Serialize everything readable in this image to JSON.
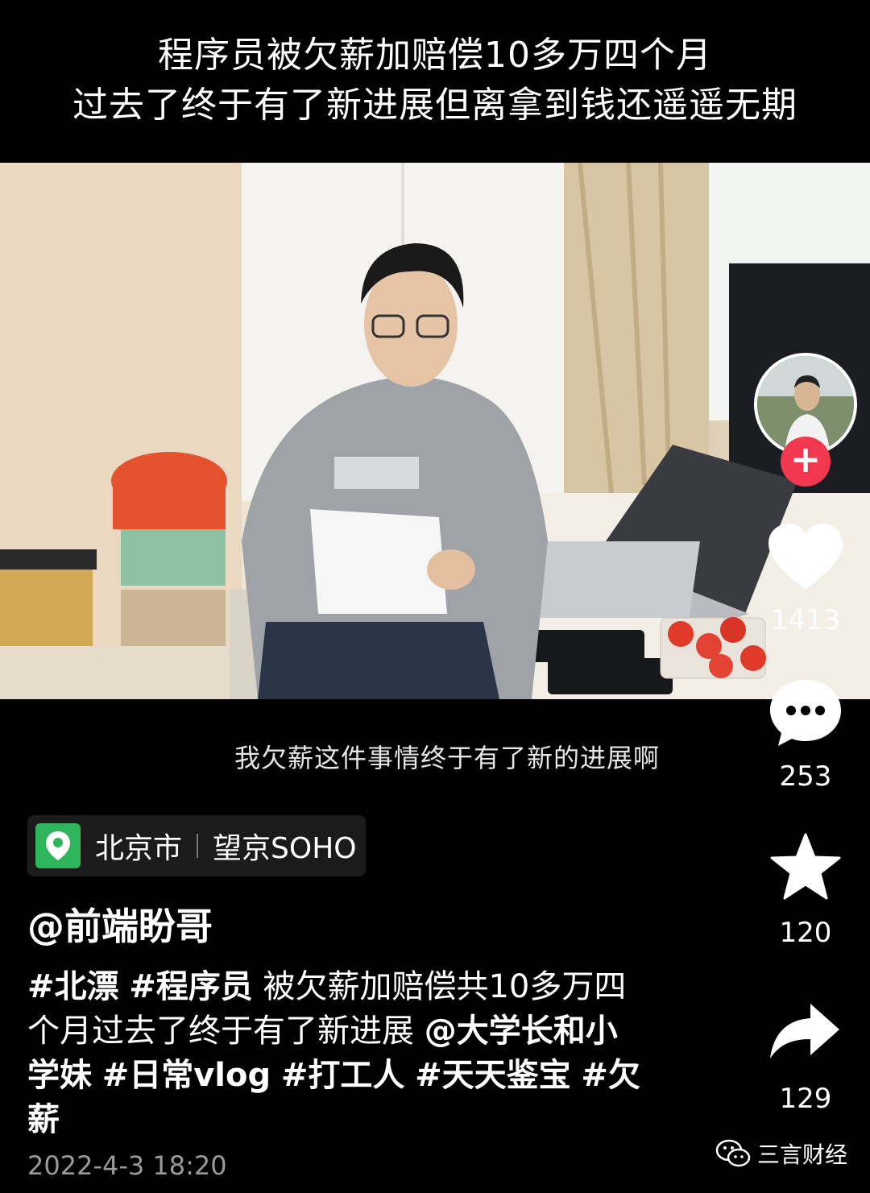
{
  "headline": {
    "line1": "程序员被欠薪加赔偿10多万四个月",
    "line2": "过去了终于有了新进展但离拿到钱还遥遥无期"
  },
  "video": {
    "subtitle": "我欠薪这件事情终于有了新的进展啊"
  },
  "location": {
    "city": "北京市",
    "place": "望京SOHO"
  },
  "author": {
    "handle": "@前端盼哥"
  },
  "description": {
    "tag1": "#北漂",
    "tag2": "#程序员",
    "text1": " 被欠薪加赔偿共10多万四个月过去了终于有了新进展",
    "mention": "@大学长和小学妹",
    "tag3": "#日常vlog",
    "tag4": "#打工人",
    "tag5": "#天天鉴宝",
    "tag6": "#欠薪"
  },
  "post_date": "2022-4-3 18:20",
  "actions": {
    "likes": "1413",
    "comments": "253",
    "favorites": "120",
    "shares": "129"
  },
  "watermark": {
    "label": "三言财经"
  },
  "icons": {
    "follow": "plus-icon",
    "like": "heart-icon",
    "comment": "comment-bubble-icon",
    "favorite": "star-icon",
    "share": "share-arrow-icon",
    "location": "map-pin-icon",
    "watermark": "wechat-icon"
  },
  "colors": {
    "follow_button": "#f2384f",
    "location_pin": "#2fb55c",
    "date_text": "#9a9a9a"
  }
}
